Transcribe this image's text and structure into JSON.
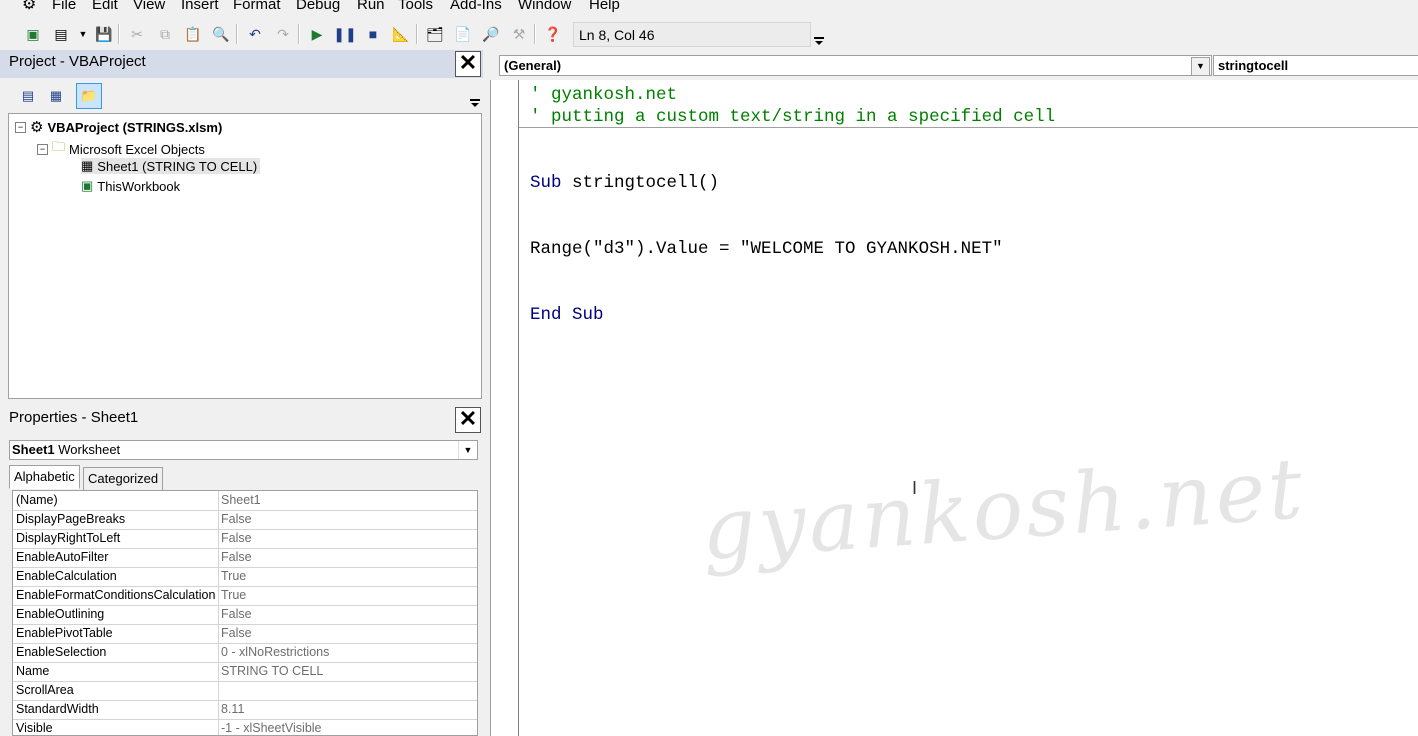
{
  "menubar": {
    "items": [
      {
        "label": "File",
        "underline": "F",
        "rest": "ile"
      },
      {
        "label": "Edit",
        "underline": "E",
        "rest": "dit"
      },
      {
        "label": "View",
        "underline": "V",
        "rest": "iew"
      },
      {
        "label": "Insert",
        "underline": "I",
        "rest": "nsert"
      },
      {
        "label": "Format",
        "underline": "o",
        "pre": "F",
        "rest": "rmat"
      },
      {
        "label": "Debug",
        "underline": "D",
        "rest": "ebug"
      },
      {
        "label": "Run",
        "underline": "R",
        "rest": "un"
      },
      {
        "label": "Tools",
        "underline": "T",
        "rest": "ools"
      },
      {
        "label": "Add-Ins",
        "underline": "A",
        "rest": "dd-Ins"
      },
      {
        "label": "Window",
        "underline": "W",
        "rest": "indow"
      },
      {
        "label": "Help",
        "underline": "H",
        "rest": "elp"
      }
    ]
  },
  "toolbar": {
    "status": "Ln 8, Col 46"
  },
  "project": {
    "title": "Project - VBAProject",
    "root": "VBAProject (STRINGS.xlsm)",
    "folder": "Microsoft Excel Objects",
    "sheet1": "Sheet1 (STRING TO CELL)",
    "workbook": "ThisWorkbook"
  },
  "properties": {
    "title": "Properties - Sheet1",
    "object_name": "Sheet1",
    "object_type": "Worksheet",
    "tabs": [
      "Alphabetic",
      "Categorized"
    ],
    "rows": [
      {
        "name": "(Name)",
        "value": "Sheet1"
      },
      {
        "name": "DisplayPageBreaks",
        "value": "False"
      },
      {
        "name": "DisplayRightToLeft",
        "value": "False"
      },
      {
        "name": "EnableAutoFilter",
        "value": "False"
      },
      {
        "name": "EnableCalculation",
        "value": "True"
      },
      {
        "name": "EnableFormatConditionsCalculation",
        "value": "True"
      },
      {
        "name": "EnableOutlining",
        "value": "False"
      },
      {
        "name": "EnablePivotTable",
        "value": "False"
      },
      {
        "name": "EnableSelection",
        "value": "0 - xlNoRestrictions"
      },
      {
        "name": "Name",
        "value": "STRING TO CELL"
      },
      {
        "name": "ScrollArea",
        "value": ""
      },
      {
        "name": "StandardWidth",
        "value": "8.11"
      },
      {
        "name": "Visible",
        "value": "-1 - xlSheetVisible"
      }
    ]
  },
  "code": {
    "object_combo": "(General)",
    "proc_combo": "stringtocell",
    "comment1": "' gyankosh.net",
    "comment2": "' putting a custom text/string in a specified cell",
    "sub_keyword": "Sub",
    "sub_name": " stringtocell()",
    "statement": "Range(\"d3\").Value = \"WELCOME TO GYANKOSH.NET\"",
    "end_sub": "End Sub"
  },
  "watermark": "gyankosh.net",
  "colors": {
    "comment": "#008000",
    "keyword": "#00007f",
    "panel_title": "#d6dbe9"
  }
}
